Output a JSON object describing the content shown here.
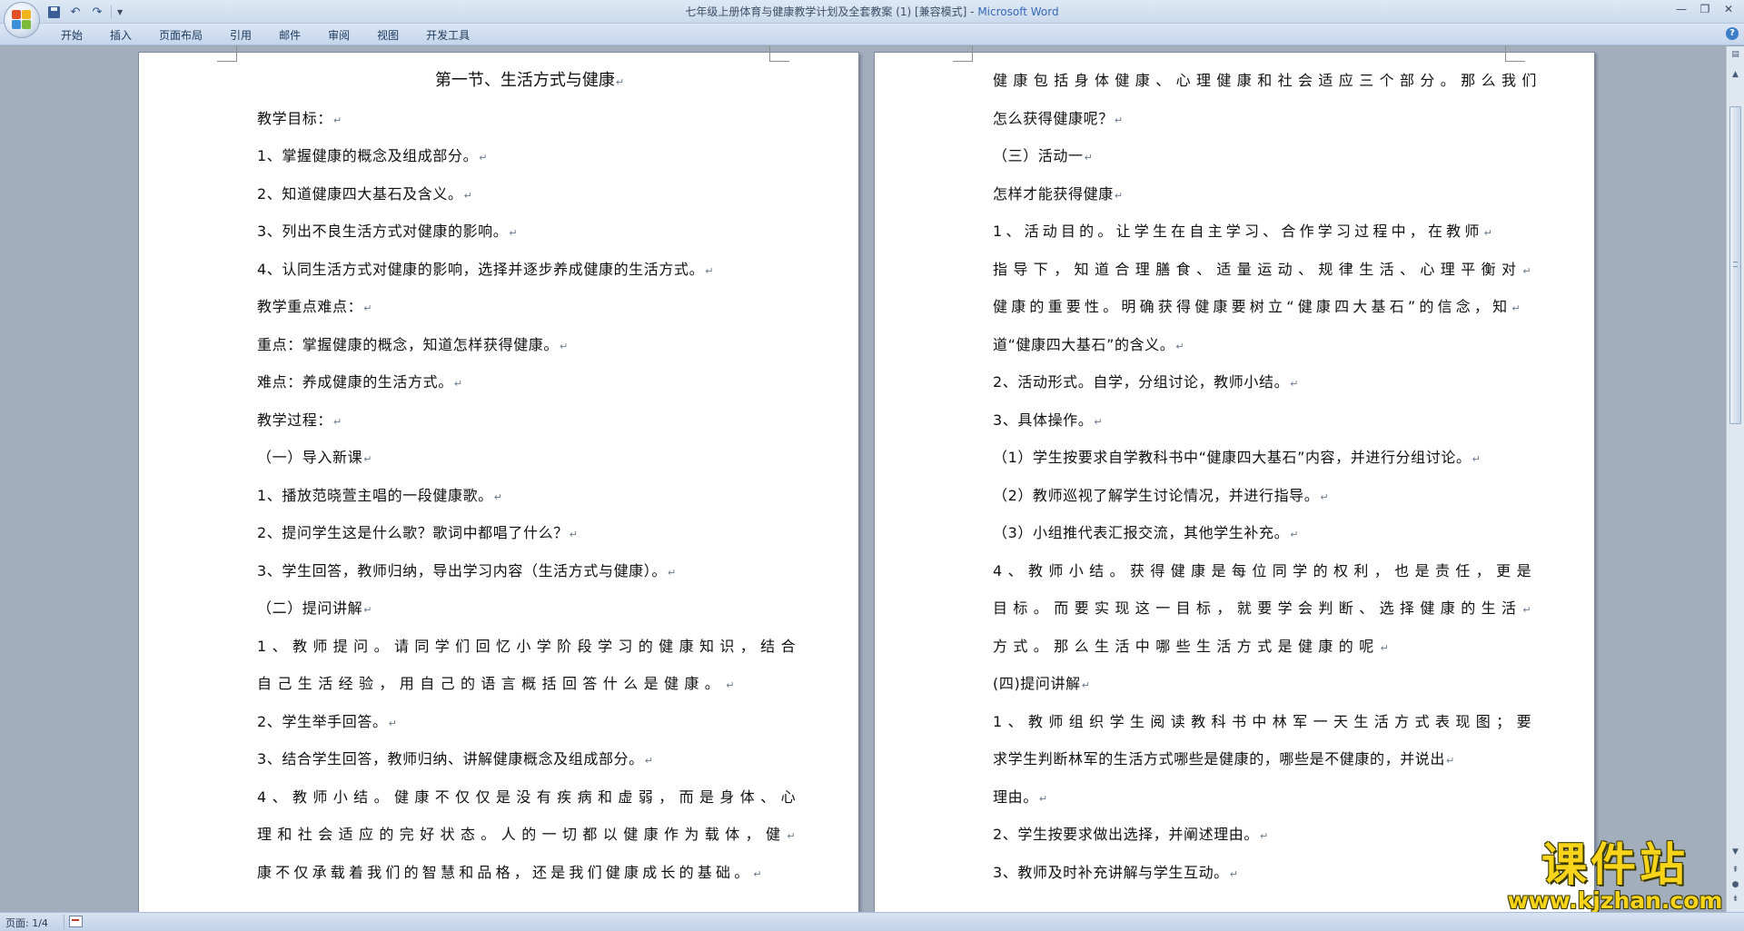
{
  "window": {
    "title": "七年级上册体育与健康教学计划及全套教案 (1) [兼容模式] - ",
    "app": "Microsoft Word"
  },
  "quick_access": {
    "save": "save-icon",
    "undo": "↶",
    "redo": "↷",
    "customize": "▼"
  },
  "window_controls": {
    "minimize": "—",
    "restore": "❐",
    "close": "✕"
  },
  "ribbon": {
    "tabs": [
      "开始",
      "插入",
      "页面布局",
      "引用",
      "邮件",
      "审阅",
      "视图",
      "开发工具"
    ],
    "help": "?"
  },
  "pages": {
    "left": [
      "第一节、生活方式与健康",
      "教学目标：",
      "1、掌握健康的概念及组成部分。",
      "2、知道健康四大基石及含义。",
      "3、列出不良生活方式对健康的影响。",
      "4、认同生活方式对健康的影响，选择并逐步养成健康的生活方式。",
      "教学重点难点：",
      "重点：掌握健康的概念，知道怎样获得健康。",
      "难点：养成健康的生活方式。",
      " 教学过程：",
      "（一）导入新课",
      "1、播放范晓萱主唱的一段健康歌。",
      "2、提问学生这是什么歌？歌词中都唱了什么？",
      "3、学生回答，教师归纳，导出学习内容（生活方式与健康）。",
      "（二）提问讲解",
      "1、教师提问。请同学们回忆小学阶段学习的健康知识，结合",
      "自己生活经验，用自己的语言概括回答什么是健康。",
      "2、学生举手回答。",
      "3、结合学生回答，教师归纳、讲解健康概念及组成部分。",
      "4、教师小结。健康不仅仅是没有疾病和虚弱，而是身体、心",
      "理和社会适应的完好状态。人的一切都以健康作为载体，健",
      "康不仅承载着我们的智慧和品格，还是我们健康成长的基础。"
    ],
    "right": [
      "健康包括身体健康、心理健康和社会适应三个部分。那么我们",
      "怎么获得健康呢？",
      " （三）活动一",
      " 怎样才能获得健康",
      " 1、活动目的。让学生在自主学习、合作学习过程中，在教师",
      "指导下，知道合理膳食、适量运动、规律生活、心理平衡对",
      "健康的重要性。明确获得健康要树立“健康四大基石”的信念，知",
      "道“健康四大基石”的含义。",
      "2、活动形式。自学，分组讨论，教师小结。",
      "3、具体操作。",
      "（1）学生按要求自学教科书中“健康四大基石”内容，并进行分组讨论。",
      "（2）教师巡视了解学生讨论情况，并进行指导。",
      "（3）小组推代表汇报交流，其他学生补充。",
      "4、教师小结。获得健康是每位同学的权利，也是责任，更是",
      "目标。而要实现这一目标，就要学会判断、选择健康的生活",
      "方式。那么生活中哪些生活方式是健康的呢",
      "(四)提问讲解",
      " 1、教师组织学生阅读教科书中林军一天生活方式表现图；要",
      "求学生判断林军的生活方式哪些是健康的，哪些是不健康的，并说出",
      "理由。",
      "2、学生按要求做出选择，并阐述理由。",
      "3、教师及时补充讲解与学生互动。"
    ]
  },
  "status_bar": {
    "page": "页面: 1/4"
  },
  "watermark": {
    "name": "课件站",
    "url": "www.kjzhan.com"
  },
  "colors": {
    "title_app": "#3869b5",
    "watermark": "#f7d41a",
    "workspace": "#a3aebd"
  }
}
